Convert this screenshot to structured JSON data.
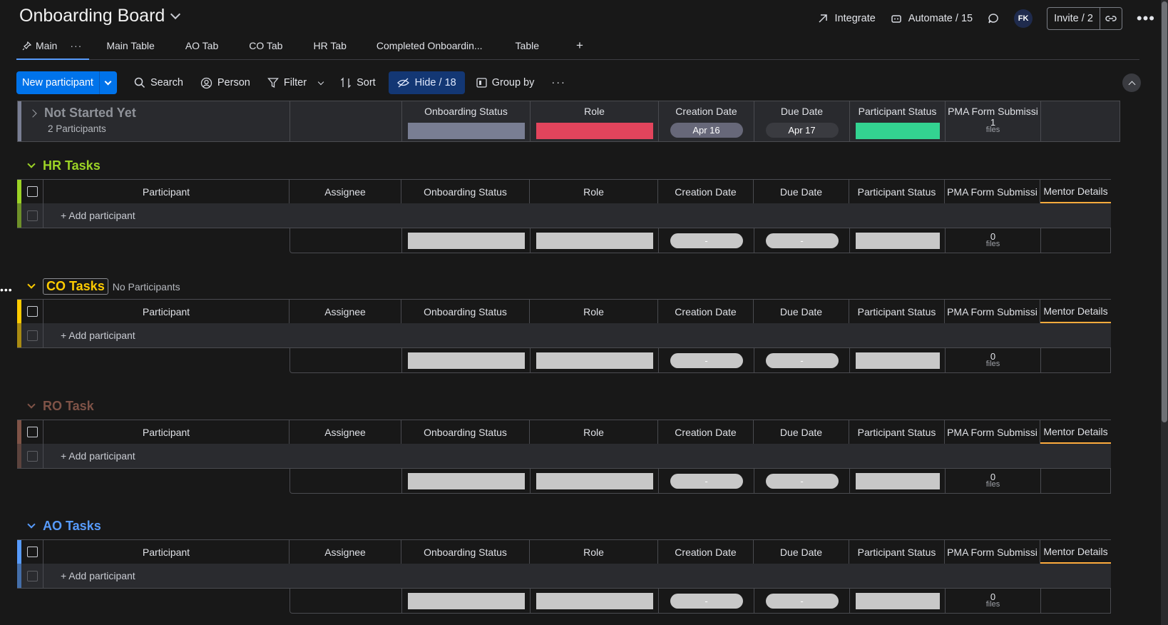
{
  "board": {
    "title": "Onboarding Board"
  },
  "top": {
    "integrate": "Integrate",
    "automate": "Automate / 15",
    "avatar": "FK",
    "invite": "Invite / 2"
  },
  "tabs": [
    {
      "label": "Main"
    },
    {
      "label": "Main Table"
    },
    {
      "label": "AO Tab"
    },
    {
      "label": "CO Tab"
    },
    {
      "label": "HR Tab"
    },
    {
      "label": "Completed Onboardin..."
    },
    {
      "label": "Table"
    },
    {
      "label": "+"
    }
  ],
  "toolbar": {
    "new": "New participant",
    "search": "Search",
    "person": "Person",
    "filter": "Filter",
    "sort": "Sort",
    "hide": "Hide / 18",
    "group_by": "Group by"
  },
  "columns": {
    "participant": "Participant",
    "assignee": "Assignee",
    "onboarding": "Onboarding Status",
    "role": "Role",
    "creation": "Creation Date",
    "due": "Due Date",
    "pstatus": "Participant Status",
    "pma": "PMA Form Submissi",
    "mentor": "Mentor Details"
  },
  "collapsed_group": {
    "name": "Not Started Yet",
    "count": "2 Participants",
    "creation": "Apr 16",
    "due": "Apr 17",
    "files_count": "1",
    "files_label": "files",
    "colors": {
      "onboarding": "#797e93",
      "role": "#e2445c",
      "pstatus": "#33d391"
    }
  },
  "groups": [
    {
      "name": "HR Tasks",
      "color": "#9cd326",
      "sub": "",
      "add": "+ Add participant",
      "dash1": "-",
      "dash2": "-",
      "files_count": "0",
      "files_label": "files"
    },
    {
      "name": "CO Tasks",
      "color": "#ffcb00",
      "sub": "No Participants",
      "add": "+ Add participant",
      "dash1": "-",
      "dash2": "-",
      "files_count": "0",
      "files_label": "files"
    },
    {
      "name": "RO Task",
      "color": "#7f5347",
      "sub": "",
      "add": "+ Add participant",
      "dash1": "-",
      "dash2": "-",
      "files_count": "0",
      "files_label": "files"
    },
    {
      "name": "AO Tasks",
      "color": "#579bfc",
      "sub": "",
      "add": "+ Add participant",
      "dash1": "-",
      "dash2": "-",
      "files_count": "0",
      "files_label": "files"
    }
  ]
}
